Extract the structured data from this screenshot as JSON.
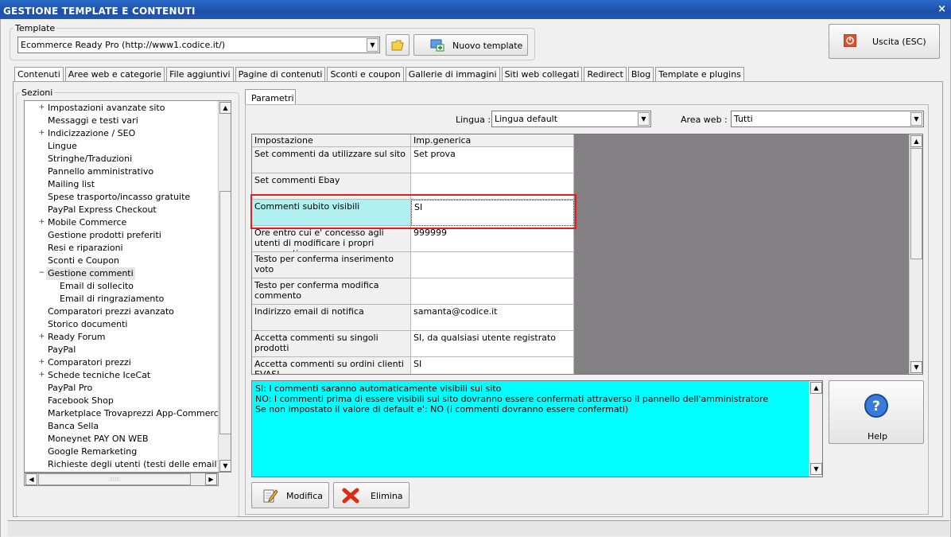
{
  "window": {
    "title": "GESTIONE TEMPLATE E CONTENUTI",
    "close": "×"
  },
  "template_group": {
    "label": "Template",
    "selected": "Ecommerce Ready Pro (http://www1.codice.it/)",
    "new_button": "Nuovo template"
  },
  "exit_button": "Uscita (ESC)",
  "tabs": [
    "Contenuti",
    "Aree web e categorie",
    "File aggiuntivi",
    "Pagine di contenuti",
    "Sconti e coupon",
    "Gallerie di immagini",
    "Siti web collegati",
    "Redirect",
    "Blog",
    "Template e plugins"
  ],
  "sections": {
    "label": "Sezioni",
    "items": [
      {
        "label": "Impostazioni avanzate sito",
        "toggle": "+",
        "level": 0
      },
      {
        "label": "Messaggi e testi vari",
        "toggle": "",
        "level": 0
      },
      {
        "label": "Indicizzazione / SEO",
        "toggle": "+",
        "level": 0
      },
      {
        "label": "Lingue",
        "toggle": "",
        "level": 0
      },
      {
        "label": "Stringhe/Traduzioni",
        "toggle": "",
        "level": 0
      },
      {
        "label": "Pannello amministrativo",
        "toggle": "",
        "level": 0
      },
      {
        "label": "Mailing list",
        "toggle": "",
        "level": 0
      },
      {
        "label": "Spese trasporto/incasso gratuite",
        "toggle": "",
        "level": 0
      },
      {
        "label": "PayPal Express Checkout",
        "toggle": "",
        "level": 0
      },
      {
        "label": "Mobile Commerce",
        "toggle": "+",
        "level": 0
      },
      {
        "label": "Gestione prodotti preferiti",
        "toggle": "",
        "level": 0
      },
      {
        "label": "Resi e riparazioni",
        "toggle": "",
        "level": 0
      },
      {
        "label": "Sconti e Coupon",
        "toggle": "",
        "level": 0
      },
      {
        "label": "Gestione commenti",
        "toggle": "−",
        "level": 0,
        "selected": true
      },
      {
        "label": "Email di sollecito",
        "toggle": "",
        "level": 1
      },
      {
        "label": "Email di ringraziamento",
        "toggle": "",
        "level": 1
      },
      {
        "label": "Comparatori prezzi avanzato",
        "toggle": "",
        "level": 0
      },
      {
        "label": "Storico documenti",
        "toggle": "",
        "level": 0
      },
      {
        "label": "Ready Forum",
        "toggle": "+",
        "level": 0
      },
      {
        "label": "PayPal",
        "toggle": "",
        "level": 0
      },
      {
        "label": "Comparatori prezzi",
        "toggle": "+",
        "level": 0
      },
      {
        "label": "Schede tecniche IceCat",
        "toggle": "+",
        "level": 0
      },
      {
        "label": "PayPal Pro",
        "toggle": "",
        "level": 0
      },
      {
        "label": "Facebook Shop",
        "toggle": "",
        "level": 0
      },
      {
        "label": "Marketplace Trovaprezzi App-Commerce e Ki",
        "toggle": "",
        "level": 0
      },
      {
        "label": "Banca Sella",
        "toggle": "",
        "level": 0
      },
      {
        "label": "Moneynet PAY ON WEB",
        "toggle": "",
        "level": 0
      },
      {
        "label": "Google Remarketing",
        "toggle": "",
        "level": 0
      },
      {
        "label": "Richieste degli utenti (testi delle email)",
        "toggle": "",
        "level": 0
      }
    ],
    "grip": "::::::"
  },
  "params": {
    "tab_label": "Parametri",
    "lingua_label": "Lingua :",
    "lingua_value": "Lingua default",
    "area_label": "Area web :",
    "area_value": "Tutti"
  },
  "grid": {
    "col_setting": "Impostazione",
    "col_value": "Imp.generica",
    "rows": [
      {
        "key": "Set commenti da utilizzare sul sito",
        "value": "Set prova"
      },
      {
        "key": "Set commenti Ebay",
        "value": ""
      },
      {
        "key": "Commenti subito visibili",
        "value": "SI",
        "highlight": true
      },
      {
        "key": "Ore entro cui e' concesso agli utenti di modificare i propri commenti",
        "value": "999999"
      },
      {
        "key": "Testo per conferma inserimento voto",
        "value": ""
      },
      {
        "key": "Testo per conferma modifica commento",
        "value": ""
      },
      {
        "key": "Indirizzo email di notifica",
        "value": "samanta@codice.it"
      },
      {
        "key": "Accetta commenti su singoli prodotti",
        "value": "SI, da qualsiasi utente registrato"
      },
      {
        "key": "Accetta commenti su ordini clienti EVASI",
        "value": "SI"
      }
    ]
  },
  "description": {
    "lines": [
      "SI: I commenti saranno automaticamente visibili sul sito",
      "NO: I commenti prima di essere visibili sul sito dovranno essere confermati attraverso il pannello dell'amministratore",
      "Se non impostato il valore di default e': NO (i commenti dovranno essere confermati)"
    ]
  },
  "help_button": "Help",
  "modify_button": "Modifica",
  "delete_button": "Elimina",
  "colors": {
    "highlight": "#b0f0f0",
    "description_bg": "#00ffff",
    "selection_border": "#e02020",
    "title_bar": "#1c4fa8"
  }
}
